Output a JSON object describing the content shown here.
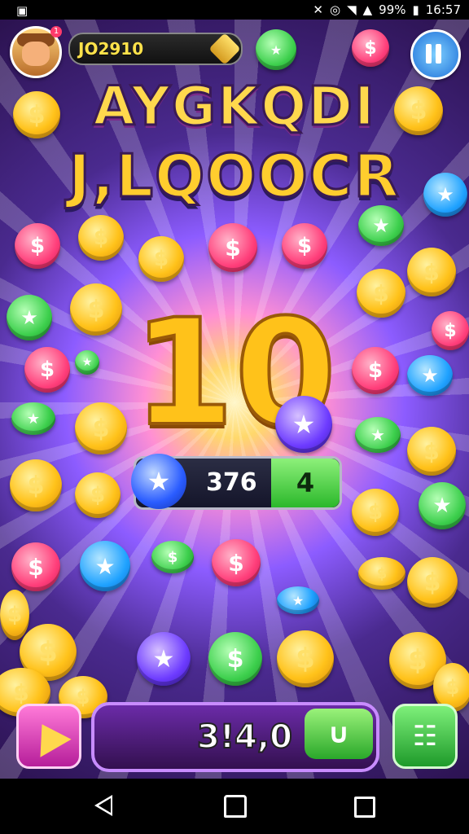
{
  "status_bar": {
    "battery": "99%",
    "time": "16:57"
  },
  "hud": {
    "score": "JO2910",
    "notification_count": "1"
  },
  "title": {
    "line1": "AYGKQDI",
    "line2": "J,LQOOCR"
  },
  "center": {
    "big_number": "10",
    "counter_value": "376",
    "counter_badge": "4"
  },
  "bottom": {
    "balance": "3!4,0"
  },
  "coin_symbols": {
    "dollar": "$",
    "star": "★"
  },
  "colors": {
    "gold": "#ffc21a",
    "pink": "#ff3e7a",
    "green": "#3ccf4c",
    "blue": "#1fa2ff",
    "purple": "#6d3bff"
  }
}
